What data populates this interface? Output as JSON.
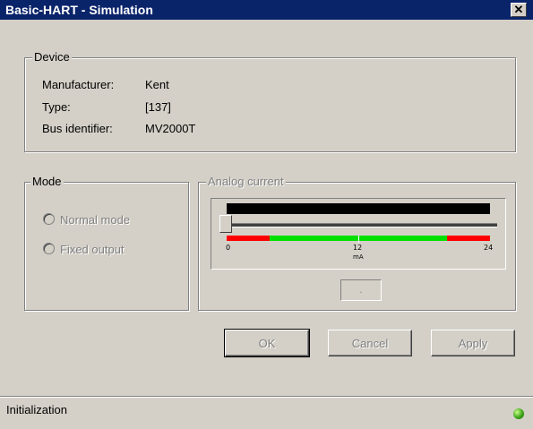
{
  "window": {
    "title": "Basic-HART - Simulation",
    "close_glyph": "✕"
  },
  "device": {
    "group_label": "Device",
    "manufacturer_label": "Manufacturer:",
    "manufacturer_value": "Kent",
    "type_label": "Type:",
    "type_value": "[137]",
    "bus_label": "Bus identifier:",
    "bus_value": "MV2000T"
  },
  "mode": {
    "group_label": "Mode",
    "options": [
      "Normal mode",
      "Fixed output"
    ]
  },
  "analog": {
    "group_label": "Analog current",
    "scale": {
      "min_label": "0",
      "mid_label": "12",
      "max_label": "24",
      "unit": "mA"
    },
    "slider_value_mA": 0,
    "readout": "."
  },
  "buttons": {
    "ok": "OK",
    "cancel": "Cancel",
    "apply": "Apply"
  },
  "status": {
    "text": "Initialization",
    "indicator_color": "#3fa318"
  },
  "colors": {
    "title_bar": "#0a246a",
    "scale_red": "#ff0000",
    "scale_green": "#00e000"
  }
}
